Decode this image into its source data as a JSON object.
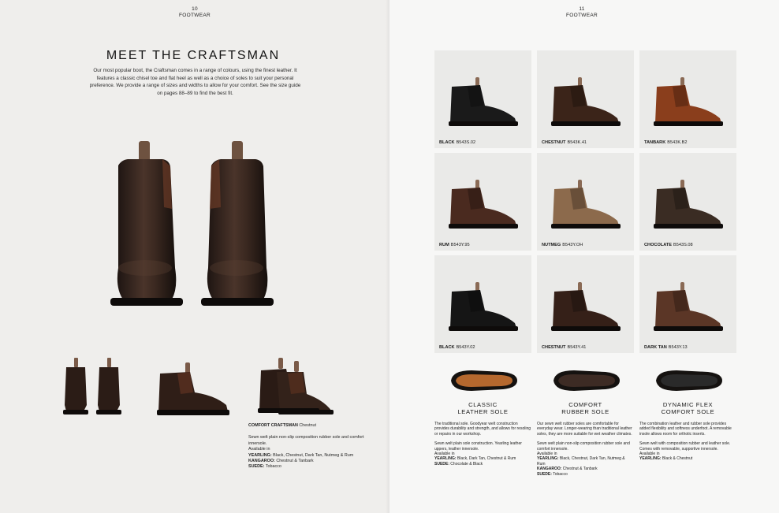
{
  "left": {
    "page_number": "10",
    "section": "FOOTWEAR",
    "title": "MEET THE CRAFTSMAN",
    "intro": "Our most popular boot, the Craftsman comes in a range of colours, using the finest leather. It features a classic chisel toe and flat heel as well as a choice of soles to suit your personal preference. We provide a range of sizes and widths to allow for your comfort. See the size guide on pages 88–89 to find the best fit.",
    "caption": {
      "name": "COMFORT CRAFTSMAN",
      "colour": "Chestnut",
      "desc1": "Sewn welt plain non-slip composition rubber sole and comfort innersole.",
      "available": "Available in",
      "yearling_label": "YEARLING:",
      "yearling_value": "Black, Chestnut, Dark Tan, Nutmeg & Rum",
      "kangaroo_label": "KANGAROO:",
      "kangaroo_value": "Chestnut & Tanbark",
      "suede_label": "SUEDE:",
      "suede_value": "Tobacco"
    }
  },
  "right": {
    "page_number": "11",
    "section": "FOOTWEAR",
    "tiles": [
      {
        "name": "BLACK",
        "code": "B543S.02",
        "color": "#1a1a1a"
      },
      {
        "name": "CHESTNUT",
        "code": "B543K.41",
        "color": "#3b2419"
      },
      {
        "name": "TANBARK",
        "code": "B543K.B2",
        "color": "#8a3e1c"
      },
      {
        "name": "RUM",
        "code": "B543Y.95",
        "color": "#4a2a1f"
      },
      {
        "name": "NUTMEG",
        "code": "B543Y.OH",
        "color": "#8c6a4c"
      },
      {
        "name": "CHOCOLATE",
        "code": "B543S.08",
        "color": "#3a2c23"
      },
      {
        "name": "BLACK",
        "code": "B543Y.02",
        "color": "#151515"
      },
      {
        "name": "CHESTNUT",
        "code": "B543Y.41",
        "color": "#352018"
      },
      {
        "name": "DARK TAN",
        "code": "B543Y.13",
        "color": "#5b3626"
      }
    ],
    "soles": [
      {
        "title_line1": "CLASSIC",
        "title_line2": "LEATHER SOLE",
        "desc": "The traditional sole. Goodyear welt construction provides durability and strength, and allows for resoling or repairs in our workshop.",
        "desc2": "Sewn welt plain sole construction. Yearling leather uppers, leather innersole.",
        "available": "Available in",
        "l1": "YEARLING:",
        "v1": "Black, Dark Tan, Chestnut & Rum",
        "l2": "SUEDE:",
        "v2": "Chocolate & Black",
        "l3": "",
        "v3": "",
        "sole_color": "#b5682e"
      },
      {
        "title_line1": "COMFORT",
        "title_line2": "RUBBER SOLE",
        "desc": "Our sewn welt rubber soles are comfortable for everyday wear. Longer-wearing than traditional leather soles, they are more suitable for wet weather climates.",
        "desc2": "Sewn welt plain non-slip composition rubber sole and comfort innersole.",
        "available": "Available in",
        "l1": "YEARLING:",
        "v1": "Black, Chestnut, Dark Tan, Nutmeg & Rum",
        "l2": "KANGAROO:",
        "v2": "Chestnut & Tanbark",
        "l3": "SUEDE:",
        "v3": "Tobacco",
        "sole_color": "#3d2b24"
      },
      {
        "title_line1": "DYNAMIC FLEX",
        "title_line2": "COMFORT SOLE",
        "desc": "The combination leather and rubber sole provides added flexibility and softness underfoot. A removable insole allows room for orthotic inserts.",
        "desc2": "Sewn welt with composition rubber and leather sole. Comes with removable, supportive innersole.",
        "available": "Available in",
        "l1": "YEARLING:",
        "v1": "Black & Chestnut",
        "l2": "",
        "v2": "",
        "l3": "",
        "v3": "",
        "sole_color": "#2a2a2a"
      }
    ]
  }
}
